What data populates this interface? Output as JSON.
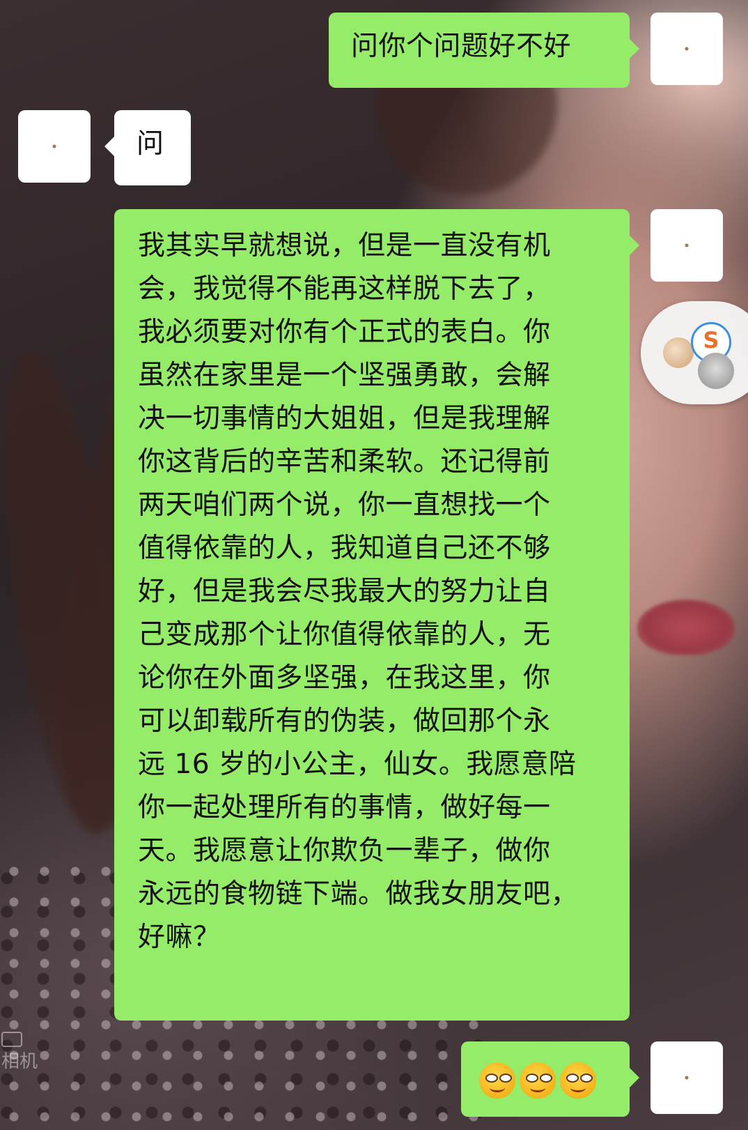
{
  "messages": [
    {
      "id": "m1",
      "direction": "sent",
      "text": "问你个问题好不好"
    },
    {
      "id": "m2",
      "direction": "received",
      "text": "问"
    },
    {
      "id": "m3",
      "direction": "sent",
      "text": "我其实早就想说，但是一直没有机\n会，我觉得不能再这样脱下去了，\n我必须要对你有个正式的表白。你\n虽然在家里是一个坚强勇敢，会解\n决一切事情的大姐姐，但是我理解\n你这背后的辛苦和柔软。还记得前\n两天咱们两个说，你一直想找一个\n值得依靠的人，我知道自己还不够\n好，但是我会尽我最大的努力让自\n己变成那个让你值得依靠的人，无\n论你在外面多坚强，在我这里，你\n可以卸载所有的伪装，做回那个永\n远 16 岁的小公主，仙女。我愿意陪\n你一起处理所有的事情，做好每一\n天。我愿意让你欺负一辈子，做你\n永远的食物链下端。做我女朋友吧，\n好嘛？"
    },
    {
      "id": "m4",
      "direction": "sent",
      "emoji": [
        "smirk-emoji",
        "smirk-emoji",
        "smirk-emoji"
      ]
    }
  ],
  "watermark": {
    "label": "相机"
  },
  "floating_widget": {
    "icons": [
      "cartoon-avatar-icon",
      "s-logo-icon",
      "robot-avatar-icon"
    ]
  },
  "colors": {
    "sent_bubble": "#95ec69",
    "received_bubble": "#ffffff",
    "text": "#111111"
  }
}
